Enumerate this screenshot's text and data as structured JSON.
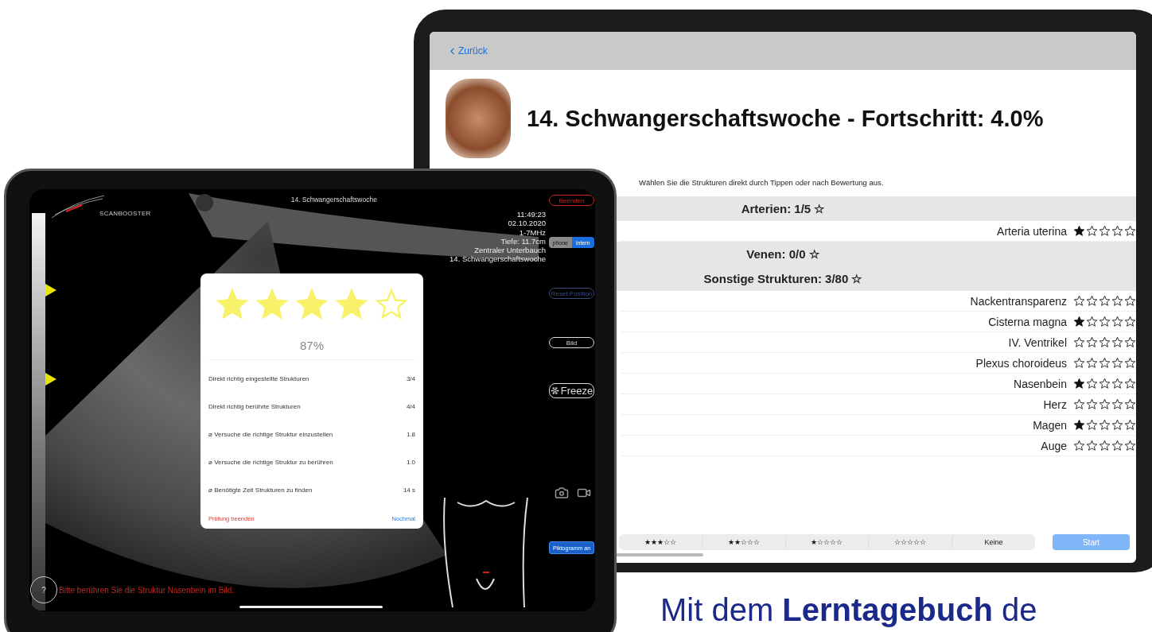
{
  "back_screen": {
    "back_link": "Zurück",
    "title": "14. Schwangerschaftswoche - Fortschritt: 4.0%",
    "instruction": "Wählen Sie die Strukturen direkt durch Tippen oder nach Bewertung aus.",
    "sections": [
      {
        "title": "Arterien: 1/5 ☆",
        "items": [
          {
            "name": "Arteria uterina",
            "stars": 1
          }
        ]
      },
      {
        "title": "Venen: 0/0 ☆"
      },
      {
        "title": "Sonstige Strukturen: 3/80 ☆",
        "items": [
          {
            "name": "Nackentransparenz",
            "stars": 0
          },
          {
            "name": "Cisterna magna",
            "stars": 1
          },
          {
            "name": "IV. Ventrikel",
            "stars": 0
          },
          {
            "name": "Plexus choroideus",
            "stars": 0
          },
          {
            "name": "Nasenbein",
            "stars": 1
          },
          {
            "name": "Herz",
            "stars": 0
          },
          {
            "name": "Magen",
            "stars": 1
          },
          {
            "name": "Auge",
            "stars": 0
          }
        ]
      }
    ],
    "filters": [
      {
        "label": "★★★☆☆",
        "selected": false
      },
      {
        "label": "★★☆☆☆",
        "selected": false
      },
      {
        "label": "★☆☆☆☆",
        "selected": false
      },
      {
        "label": "☆☆☆☆☆",
        "selected": false
      },
      {
        "label": "Keine",
        "selected": false
      }
    ],
    "start_button": "Start"
  },
  "front_screen": {
    "logo": "SCANBOOSTER",
    "title": "14. Schwangerschaftswoche",
    "end_button": "Beenden",
    "info_lines": [
      "11:49:23",
      "02.10.2020",
      "1-7MHz",
      "Tiefe: 11.7cm",
      "Zentraler Unterbauch",
      "14. Schwangerschaftswoche"
    ],
    "source_toggle": [
      {
        "label": "phone",
        "selected": false
      },
      {
        "label": "intern",
        "selected": true
      }
    ],
    "reset_button": "Reset Position",
    "image_button": "Bild",
    "freeze_button": "Freeze",
    "pictogram_button": "Piktogramm an",
    "help_button": "?",
    "prompt": "Bitte berühren Sie die Struktur Nasenbein im Bild.",
    "result": {
      "stars": 4,
      "percent": "87%",
      "rows": [
        {
          "label": "Direkt richtig eingestellte Strukturen",
          "value": "3/4"
        },
        {
          "label": "Direkt richtig berührte Strukturen",
          "value": "4/4"
        },
        {
          "label": "⌀ Versuche die richtige Struktur einzustellen",
          "value": "1.8"
        },
        {
          "label": "⌀ Versuche die richtige Struktur zu berühren",
          "value": "1.0"
        },
        {
          "label": "⌀ Benötigte Zeit Strukturen zu finden",
          "value": "14 s"
        }
      ],
      "quit": "Prüfung beenden",
      "retry": "Nochmal"
    }
  },
  "caption": "Mit dem **Lerntagebuch** de"
}
